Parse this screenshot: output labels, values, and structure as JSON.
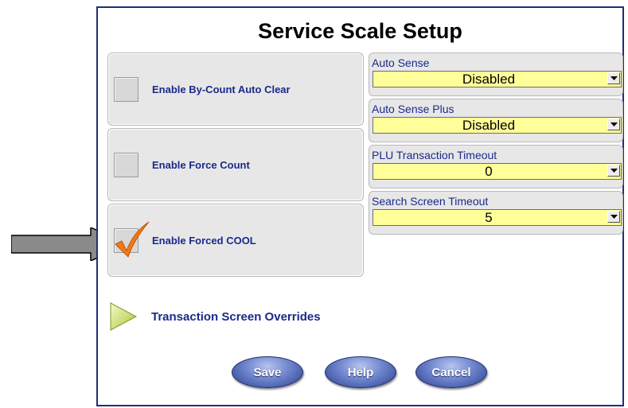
{
  "title": "Service Scale Setup",
  "checkboxes": [
    {
      "label": "Enable By-Count Auto Clear",
      "checked": false
    },
    {
      "label": "Enable Force Count",
      "checked": false
    },
    {
      "label": "Enable Forced COOL",
      "checked": true
    }
  ],
  "dropdowns": [
    {
      "label": "Auto Sense",
      "value": "Disabled"
    },
    {
      "label": "Auto Sense Plus",
      "value": "Disabled"
    },
    {
      "label": "PLU Transaction Timeout",
      "value": "0"
    },
    {
      "label": "Search Screen Timeout",
      "value": "5"
    }
  ],
  "overrides_label": "Transaction Screen Overrides",
  "buttons": {
    "save": "Save",
    "help": "Help",
    "cancel": "Cancel"
  },
  "colors": {
    "panel": "#e7e7e7",
    "dropdown_field": "#ffff99",
    "label_text": "#1a2a8a",
    "checkmark": "#f07a18",
    "button": "#5068b8",
    "arrow_annotation": "#8a8a8a"
  }
}
